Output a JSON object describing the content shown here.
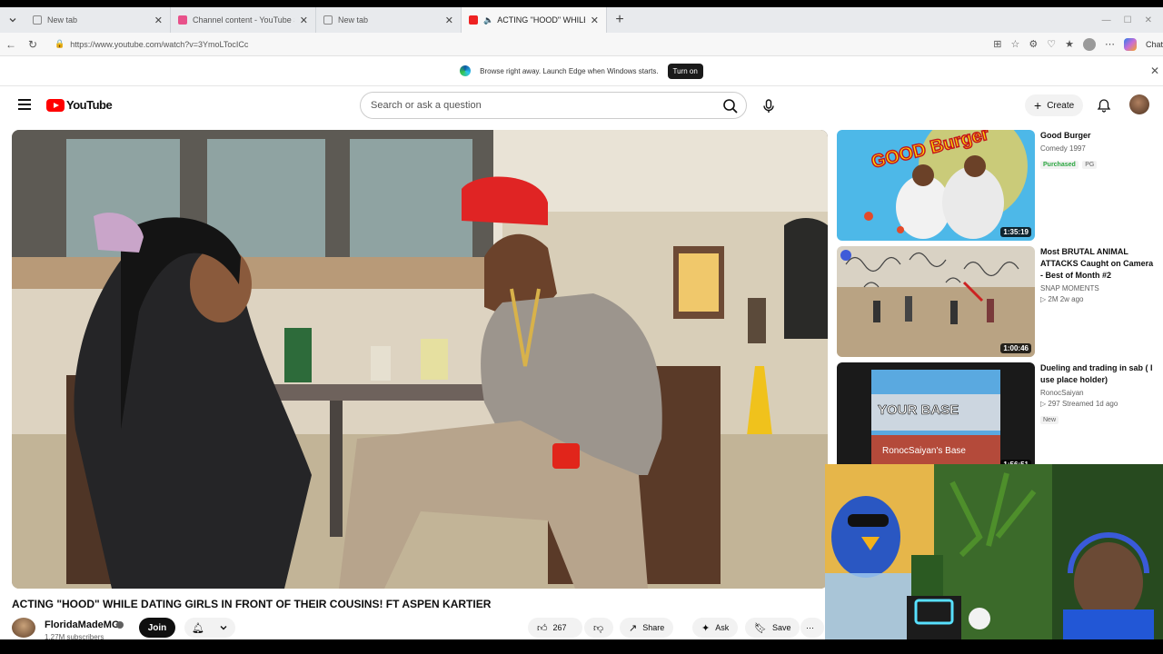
{
  "browser": {
    "tabs": [
      {
        "title": "New tab",
        "type": "newtab"
      },
      {
        "title": "Channel content - YouTube Studio",
        "type": "studio"
      },
      {
        "title": "New tab",
        "type": "newtab"
      },
      {
        "title": "ACTING \"HOOD\" WHILE DATI",
        "type": "youtube",
        "active": true
      }
    ],
    "url": "https://www.youtube.com/watch?v=3YmoLTocICc",
    "chat_label": "Chat"
  },
  "infobar": {
    "message": "Browse right away. Launch Edge when Windows starts.",
    "button": "Turn on"
  },
  "masthead": {
    "logo_text": "YouTube",
    "search_placeholder": "Search or ask a question",
    "create_label": "Create"
  },
  "video": {
    "title": "ACTING \"HOOD\" WHILE DATING GIRLS IN FRONT OF THEIR COUSINS! FT ASPEN KARTIER",
    "channel": "FloridaMadeMG",
    "subscribers": "1.27M subscribers",
    "join_label": "Join",
    "likes": "267",
    "share_label": "Share",
    "ask_label": "Ask",
    "save_label": "Save"
  },
  "recommendations": [
    {
      "title": "Good Burger",
      "line1": "Comedy 1997",
      "badges": [
        "Purchased",
        "PG"
      ],
      "duration": "1:35:19"
    },
    {
      "title": "Most BRUTAL ANIMAL ATTACKS Caught on Camera - Best of Month #2",
      "line1": "SNAP MOMENTS",
      "line2": "▷ 2M   2w ago",
      "duration": "1:00:46"
    },
    {
      "title": "Dueling and trading in sab ( I use place holder)",
      "line1": "RonocSaiyan",
      "line2": "▷ 297   Streamed 1d ago",
      "badges": [
        "New"
      ],
      "duration": "1:56:51",
      "thumb_text1": "YOUR BASE",
      "thumb_text2": "RonocSaiyan's Base"
    }
  ],
  "thumb_texts": {
    "good_burger": "GOOD Burger"
  },
  "colors": {
    "brand_red": "#ff0000",
    "purchased_green": "#2ba640"
  }
}
